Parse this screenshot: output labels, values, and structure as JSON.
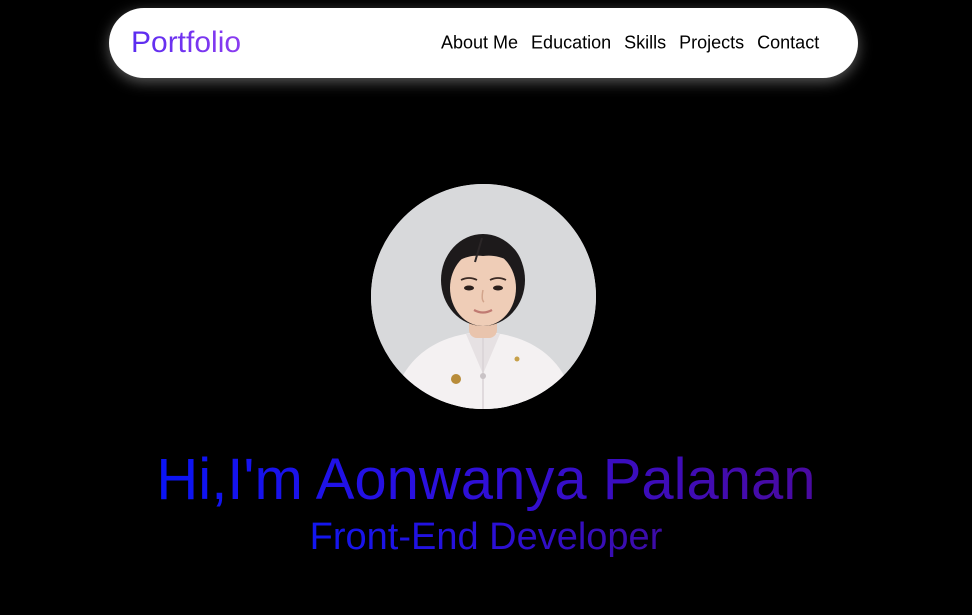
{
  "navbar": {
    "logo": "Portfolio",
    "links": [
      {
        "label": "About Me"
      },
      {
        "label": "Education"
      },
      {
        "label": "Skills"
      },
      {
        "label": "Projects"
      },
      {
        "label": "Contact"
      }
    ]
  },
  "hero": {
    "greeting": "Hi,I'm Aonwanya Palanan",
    "role": "Front-End Developer"
  },
  "colors": {
    "background": "#000000",
    "navbar_bg": "#ffffff",
    "logo_gradient_start": "#5a2cf0",
    "logo_gradient_end": "#8b3cf0",
    "headline_gradient_start": "#0a14f5",
    "headline_gradient_end": "#4a0aa0"
  }
}
